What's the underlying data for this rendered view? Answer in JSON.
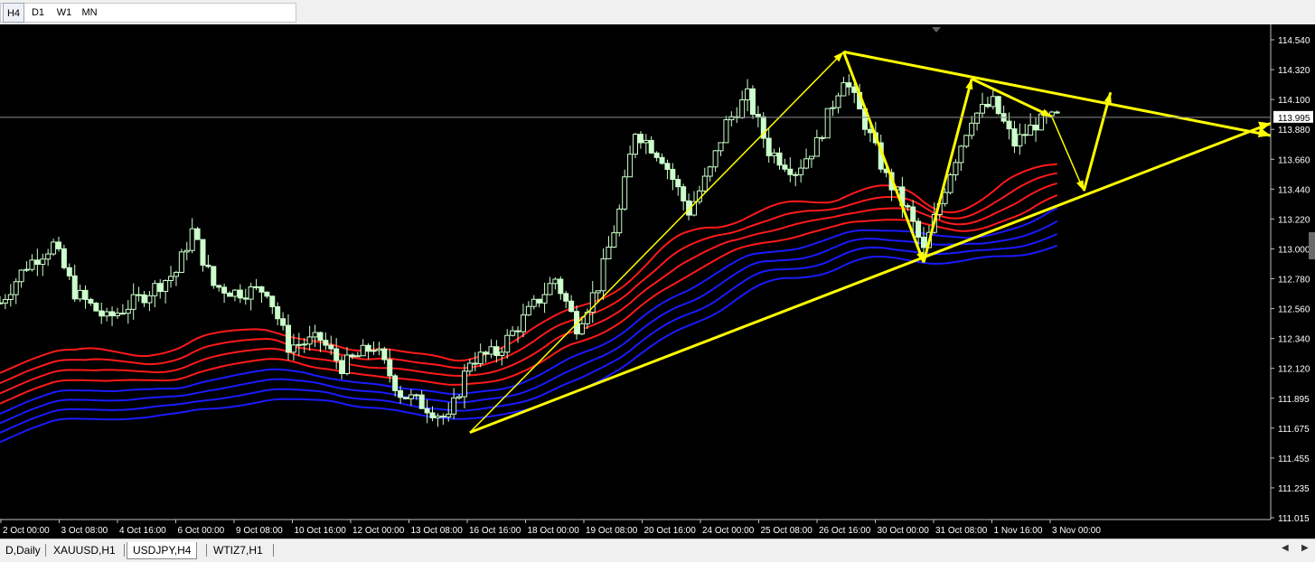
{
  "toolbar": {
    "timeframes": [
      {
        "label": "H4",
        "active": true
      },
      {
        "label": "D1",
        "active": false
      },
      {
        "label": "W1",
        "active": false
      },
      {
        "label": "MN",
        "active": false
      }
    ]
  },
  "tabs": [
    {
      "label": "D,Daily",
      "active": false
    },
    {
      "label": "XAUUSD,H1",
      "active": false
    },
    {
      "label": "USDJPY,H4",
      "active": true
    },
    {
      "label": "WTIZ7,H1",
      "active": false
    }
  ],
  "colors": {
    "background": "#000000",
    "candle": "#ccffcc",
    "red_ma": "#ff1a1a",
    "blue_ma": "#1a1aff",
    "annotation": "#ffff00",
    "text": "#ffffff"
  },
  "chart_data": {
    "type": "candlestick",
    "symbol": "USDJPY",
    "timeframe": "H4",
    "y_axis": {
      "range": [
        111.015,
        114.65
      ],
      "tick_labels": [
        "114.540",
        "114.320",
        "114.100",
        "113.880",
        "113.660",
        "113.440",
        "113.220",
        "113.000",
        "112.780",
        "112.560",
        "112.340",
        "112.120",
        "111.895",
        "111.675",
        "111.455",
        "111.235",
        "111.015"
      ],
      "current_price_label": "113.995"
    },
    "x_axis": {
      "tick_labels": [
        "2 Oct 00:00",
        "3 Oct 08:00",
        "4 Oct 16:00",
        "6 Oct 00:00",
        "9 Oct 08:00",
        "10 Oct 16:00",
        "12 Oct 00:00",
        "13 Oct 08:00",
        "16 Oct 16:00",
        "18 Oct 00:00",
        "19 Oct 08:00",
        "20 Oct 16:00",
        "24 Oct 00:00",
        "25 Oct 08:00",
        "26 Oct 16:00",
        "30 Oct 00:00",
        "31 Oct 08:00",
        "1 Nov 16:00",
        "3 Nov 00:00"
      ]
    },
    "price_path": [
      {
        "t": 0,
        "p": 112.62
      },
      {
        "t": 5,
        "p": 112.9
      },
      {
        "t": 10,
        "p": 113.05
      },
      {
        "t": 14,
        "p": 112.7
      },
      {
        "t": 20,
        "p": 112.5
      },
      {
        "t": 26,
        "p": 112.65
      },
      {
        "t": 33,
        "p": 112.85
      },
      {
        "t": 36,
        "p": 113.15
      },
      {
        "t": 40,
        "p": 112.75
      },
      {
        "t": 44,
        "p": 112.7
      },
      {
        "t": 50,
        "p": 112.72
      },
      {
        "t": 54,
        "p": 112.3
      },
      {
        "t": 60,
        "p": 112.35
      },
      {
        "t": 64,
        "p": 112.15
      },
      {
        "t": 70,
        "p": 112.3
      },
      {
        "t": 75,
        "p": 111.95
      },
      {
        "t": 80,
        "p": 111.85
      },
      {
        "t": 84,
        "p": 111.75
      },
      {
        "t": 88,
        "p": 112.2
      },
      {
        "t": 93,
        "p": 112.25
      },
      {
        "t": 99,
        "p": 112.55
      },
      {
        "t": 104,
        "p": 112.8
      },
      {
        "t": 108,
        "p": 112.45
      },
      {
        "t": 112,
        "p": 112.75
      },
      {
        "t": 116,
        "p": 113.3
      },
      {
        "t": 119,
        "p": 113.9
      },
      {
        "t": 124,
        "p": 113.7
      },
      {
        "t": 129,
        "p": 113.3
      },
      {
        "t": 133,
        "p": 113.6
      },
      {
        "t": 136,
        "p": 113.95
      },
      {
        "t": 140,
        "p": 114.15
      },
      {
        "t": 144,
        "p": 113.75
      },
      {
        "t": 149,
        "p": 113.6
      },
      {
        "t": 153,
        "p": 113.8
      },
      {
        "t": 158,
        "p": 114.3
      },
      {
        "t": 162,
        "p": 113.95
      },
      {
        "t": 166,
        "p": 113.55
      },
      {
        "t": 170,
        "p": 113.3
      },
      {
        "t": 173,
        "p": 113.0
      },
      {
        "t": 178,
        "p": 113.6
      },
      {
        "t": 182,
        "p": 114.0
      },
      {
        "t": 186,
        "p": 114.1
      },
      {
        "t": 190,
        "p": 113.8
      },
      {
        "t": 194,
        "p": 113.95
      },
      {
        "t": 198,
        "p": 113.995
      }
    ],
    "moving_averages": [
      {
        "color": "red",
        "start": 111.88,
        "end": 113.6
      },
      {
        "color": "red",
        "start": 111.8,
        "end": 113.53
      },
      {
        "color": "red",
        "start": 111.72,
        "end": 113.46
      },
      {
        "color": "red",
        "start": 111.64,
        "end": 113.38
      },
      {
        "color": "blue",
        "start": 111.56,
        "end": 113.3
      },
      {
        "color": "blue",
        "start": 111.49,
        "end": 113.23
      },
      {
        "color": "blue",
        "start": 111.42,
        "end": 113.16
      },
      {
        "color": "blue",
        "start": 111.35,
        "end": 113.09
      }
    ],
    "annotations": {
      "support_line": [
        {
          "t": 88,
          "p": 111.66
        },
        {
          "t": 238,
          "p": 113.95
        }
      ],
      "resistance_line": [
        {
          "t": 158,
          "p": 114.48
        },
        {
          "t": 238,
          "p": 113.86
        }
      ],
      "wave_path": [
        {
          "t": 88,
          "p": 111.66
        },
        {
          "t": 158,
          "p": 114.48
        },
        {
          "t": 173,
          "p": 112.92
        },
        {
          "t": 182,
          "p": 114.28
        },
        {
          "t": 197,
          "p": 114.0
        },
        {
          "t": 203,
          "p": 113.45
        },
        {
          "t": 208,
          "p": 114.18
        }
      ]
    }
  }
}
